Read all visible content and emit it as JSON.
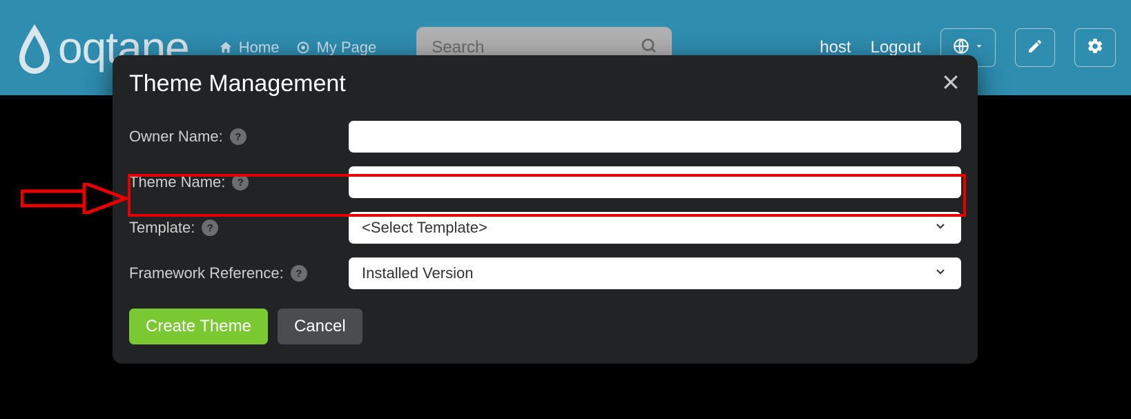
{
  "topbar": {
    "logo_text": "oqtane",
    "nav": {
      "home": "Home",
      "mypage": "My Page"
    },
    "search_placeholder": "Search",
    "user_link": "host",
    "logout": "Logout"
  },
  "modal": {
    "title": "Theme Management",
    "labels": {
      "owner": "Owner Name:",
      "theme": "Theme Name:",
      "template": "Template:",
      "framework": "Framework Reference:"
    },
    "values": {
      "owner": "",
      "theme": "",
      "template": "<Select Template>",
      "framework": "Installed Version"
    },
    "buttons": {
      "create": "Create Theme",
      "cancel": "Cancel"
    }
  }
}
